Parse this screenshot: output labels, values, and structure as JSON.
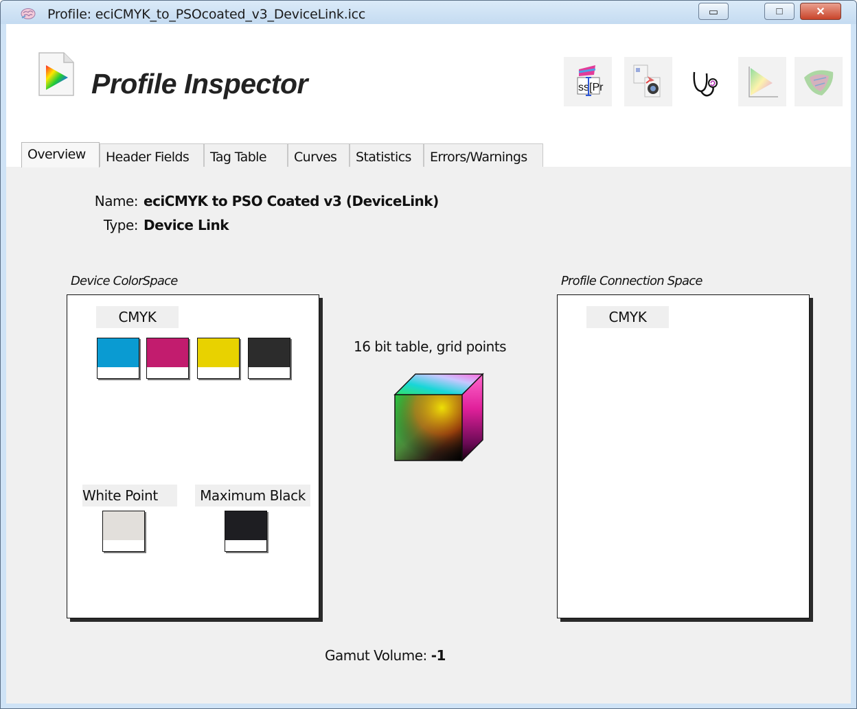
{
  "window": {
    "title": "Profile: eciCMYK_to_PSOcoated_v3_DeviceLink.icc",
    "buttons": {
      "minimize": "▭",
      "maximize": "□",
      "close": "✕"
    }
  },
  "app": {
    "title": "Profile Inspector",
    "logo_icon": "gamut-document-icon",
    "tools": [
      {
        "icon": "name-editor-icon",
        "text": "ss[Pr"
      },
      {
        "icon": "profile-convert-icon"
      },
      {
        "icon": "stethoscope-icon"
      },
      {
        "icon": "gamut-triangle-icon"
      },
      {
        "icon": "gamut-3d-icon"
      }
    ]
  },
  "tabs": [
    {
      "label": "Overview",
      "active": true
    },
    {
      "label": "Header Fields"
    },
    {
      "label": "Tag Table"
    },
    {
      "label": "Curves"
    },
    {
      "label": "Statistics"
    },
    {
      "label": "Errors/Warnings"
    }
  ],
  "overview": {
    "name_label": "Name:",
    "name_value": "eciCMYK to PSO Coated v3 (DeviceLink)",
    "type_label": "Type:",
    "type_value": "Device Link",
    "device_space": {
      "label": "Device ColorSpace",
      "colorspace": "CMYK",
      "channel_colors": [
        "#0a9bd2",
        "#c21c6e",
        "#e8d200",
        "#2c2c2c"
      ],
      "white_point_label": "White Point",
      "white_point_color": "#e2dfdb",
      "max_black_label": "Maximum Black",
      "max_black_color": "#1e1e22"
    },
    "table_caption": "16 bit table,  grid points",
    "pcs": {
      "label": "Profile Connection Space",
      "colorspace": "CMYK"
    },
    "gamut_label": "Gamut Volume:",
    "gamut_value": "-1"
  }
}
